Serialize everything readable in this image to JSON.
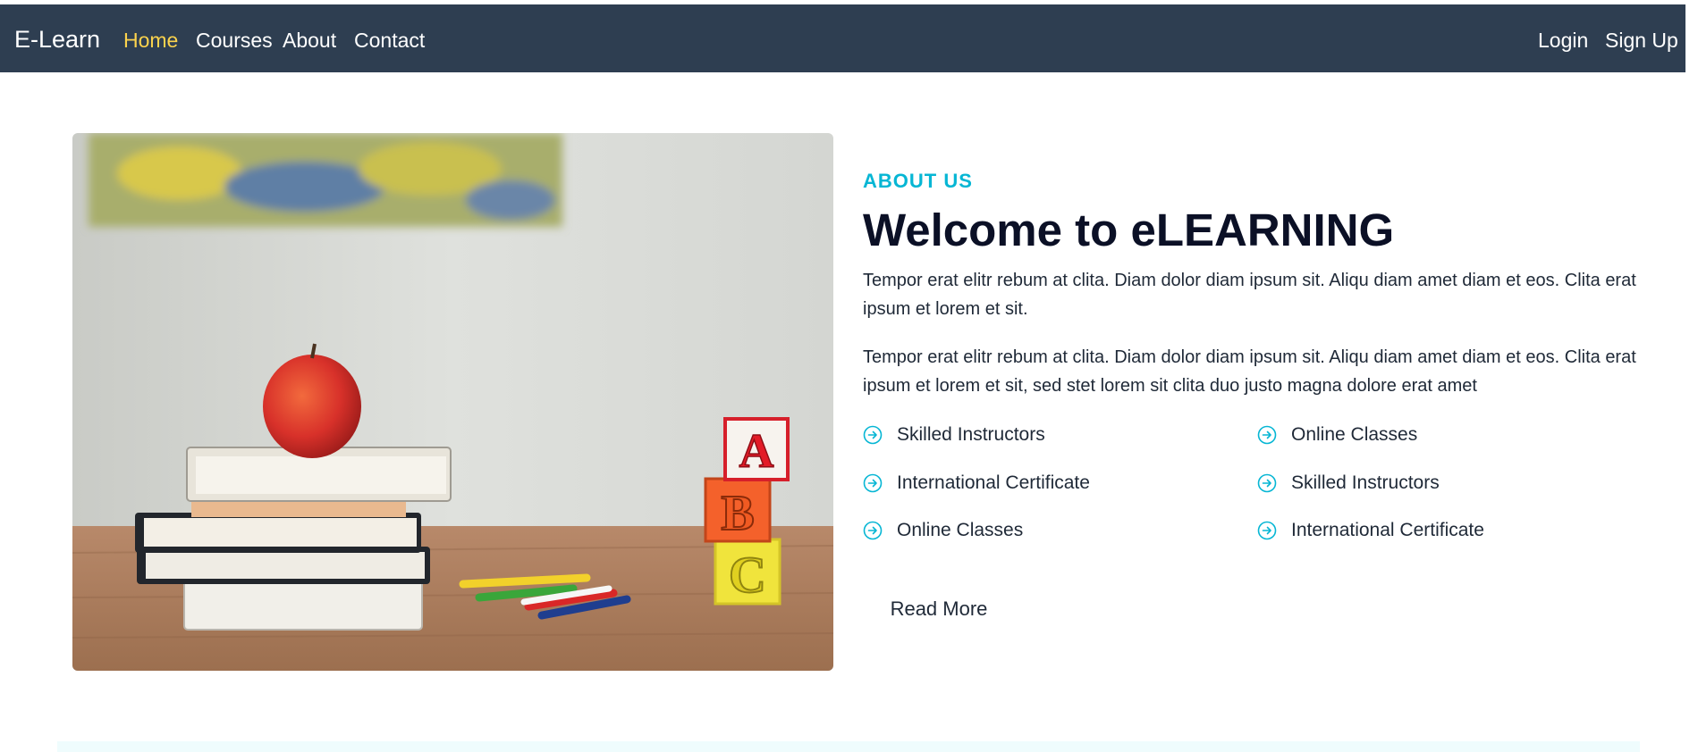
{
  "nav": {
    "brand": "E-Learn",
    "links": [
      "Home",
      "Courses",
      "About",
      "Contact"
    ],
    "active": "Home",
    "auth": [
      "Login",
      "Sign Up"
    ]
  },
  "about": {
    "eyebrow": "ABOUT US",
    "title": "Welcome to eLEARNING",
    "paragraphs": [
      "Tempor erat elitr rebum at clita. Diam dolor diam ipsum sit. Aliqu diam amet diam et eos. Clita erat ipsum et lorem et sit.",
      "Tempor erat elitr rebum at clita. Diam dolor diam ipsum sit. Aliqu diam amet diam et eos. Clita erat ipsum et lorem et sit, sed stet lorem sit clita duo justo magna dolore erat amet"
    ],
    "features_left": [
      "Skilled Instructors",
      "International Certificate",
      "Online Classes"
    ],
    "features_right": [
      "Online Classes",
      "Skilled Instructors",
      "International Certificate"
    ],
    "feature_icon": "arrow-circle-right-icon",
    "button": "Read More"
  },
  "colors": {
    "navbar": "#2e3e51",
    "active_link": "#fcd34d",
    "accent": "#06b6d4",
    "heading": "#0b1026"
  }
}
